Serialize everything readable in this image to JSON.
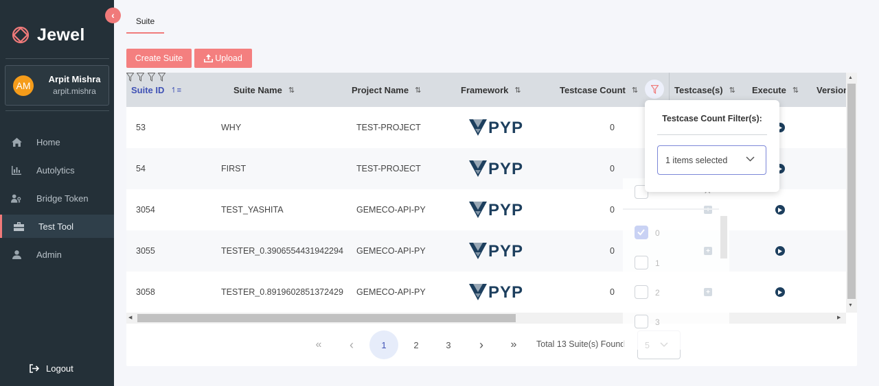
{
  "app": {
    "name": "Jewel",
    "accent": "#f07a7a",
    "collapse_icon": "chevron-left-icon"
  },
  "user": {
    "initials": "AM",
    "name": "Arpit Mishra",
    "username": "arpit.mishra"
  },
  "sidebar": {
    "items": [
      {
        "label": "Home",
        "icon": "home-icon"
      },
      {
        "label": "Autolytics",
        "icon": "bar-chart-icon"
      },
      {
        "label": "Bridge Token",
        "icon": "users-key-icon"
      },
      {
        "label": "Test Tool",
        "icon": "toolbox-icon",
        "active": true
      },
      {
        "label": "Admin",
        "icon": "user-icon"
      }
    ],
    "logout": "Logout"
  },
  "tabs": [
    {
      "label": "Suite",
      "active": true
    }
  ],
  "toolbar": {
    "create_label": "Create Suite",
    "upload_label": "Upload"
  },
  "table": {
    "columns": [
      "Suite ID",
      "Suite Name",
      "Project Name",
      "Framework",
      "Testcase Count",
      "Testcase(s)",
      "Execute",
      "Version"
    ],
    "rows": [
      {
        "id": "53",
        "name": "WHY",
        "project": "TEST-PROJECT",
        "framework": "PYP",
        "count": "0"
      },
      {
        "id": "54",
        "name": "FIRST",
        "project": "TEST-PROJECT",
        "framework": "PYP",
        "count": "0"
      },
      {
        "id": "3054",
        "name": "TEST_YASHITA",
        "project": "GEMECO-API-PY",
        "framework": "PYP",
        "count": "0"
      },
      {
        "id": "3055",
        "name": "TESTER_0.3906554431942294",
        "project": "GEMECO-API-PY",
        "framework": "PYP",
        "count": "0"
      },
      {
        "id": "3058",
        "name": "TESTER_0.8919602851372429",
        "project": "GEMECO-API-PY",
        "framework": "PYP",
        "count": "0"
      }
    ]
  },
  "pagination": {
    "first": "«",
    "prev": "‹",
    "pages": [
      "1",
      "2",
      "3"
    ],
    "current": "1",
    "next": "›",
    "last": "»",
    "total": "Total 13 Suite(s) Found",
    "page_size": "5"
  },
  "filter_popup": {
    "title": "Testcase Count Filter(s):",
    "selected": "1 items selected",
    "options": [
      {
        "label": "0",
        "checked": true
      },
      {
        "label": "1",
        "checked": false
      },
      {
        "label": "2",
        "checked": false
      },
      {
        "label": "3",
        "checked": false
      }
    ],
    "clear": "×"
  }
}
